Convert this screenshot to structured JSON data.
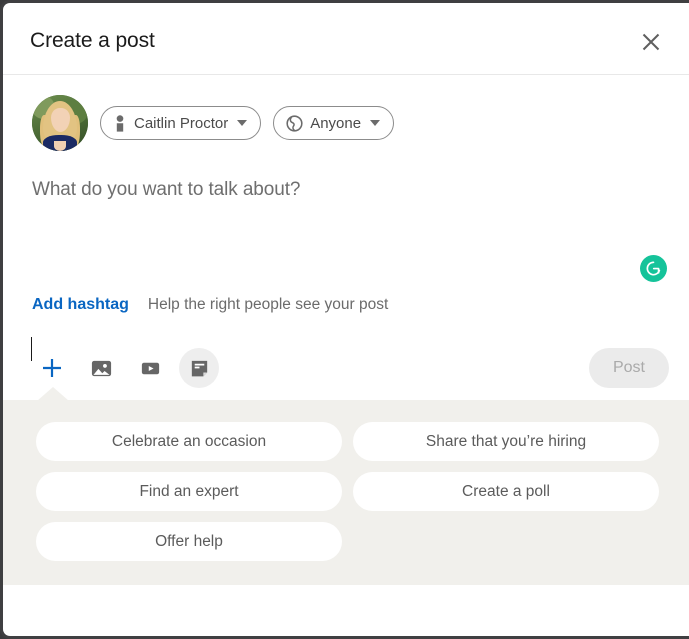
{
  "dialog": {
    "title": "Create a post",
    "close_icon": "close-icon"
  },
  "identity": {
    "avatar_alt": "Caitlin Proctor profile photo",
    "author": {
      "label": "Caitlin Proctor",
      "icon": "person-icon"
    },
    "visibility": {
      "label": "Anyone",
      "icon": "globe-icon"
    }
  },
  "compose": {
    "placeholder": "What do you want to talk about?",
    "value": "",
    "assistant_icon": "grammarly-icon"
  },
  "hashtag": {
    "link_label": "Add hashtag",
    "hint": "Help the right people see your post"
  },
  "toolbar": {
    "items": [
      {
        "name": "add-content-button",
        "icon": "plus-icon",
        "active": false
      },
      {
        "name": "add-photo-button",
        "icon": "image-icon",
        "active": false
      },
      {
        "name": "add-video-button",
        "icon": "video-icon",
        "active": false
      },
      {
        "name": "write-article-button",
        "icon": "document-icon",
        "active": true
      }
    ],
    "post_label": "Post",
    "post_enabled": false
  },
  "suggestions": {
    "chips": [
      "Celebrate an occasion",
      "Share that you’re hiring",
      "Find an expert",
      "Create a poll",
      "Offer help"
    ]
  },
  "colors": {
    "accent_blue": "#0a66c2",
    "grammarly_green": "#15c39a",
    "panel_bg": "#f1f0ec",
    "icon_gray": "#666666",
    "disabled_gray": "#ebebeb"
  }
}
